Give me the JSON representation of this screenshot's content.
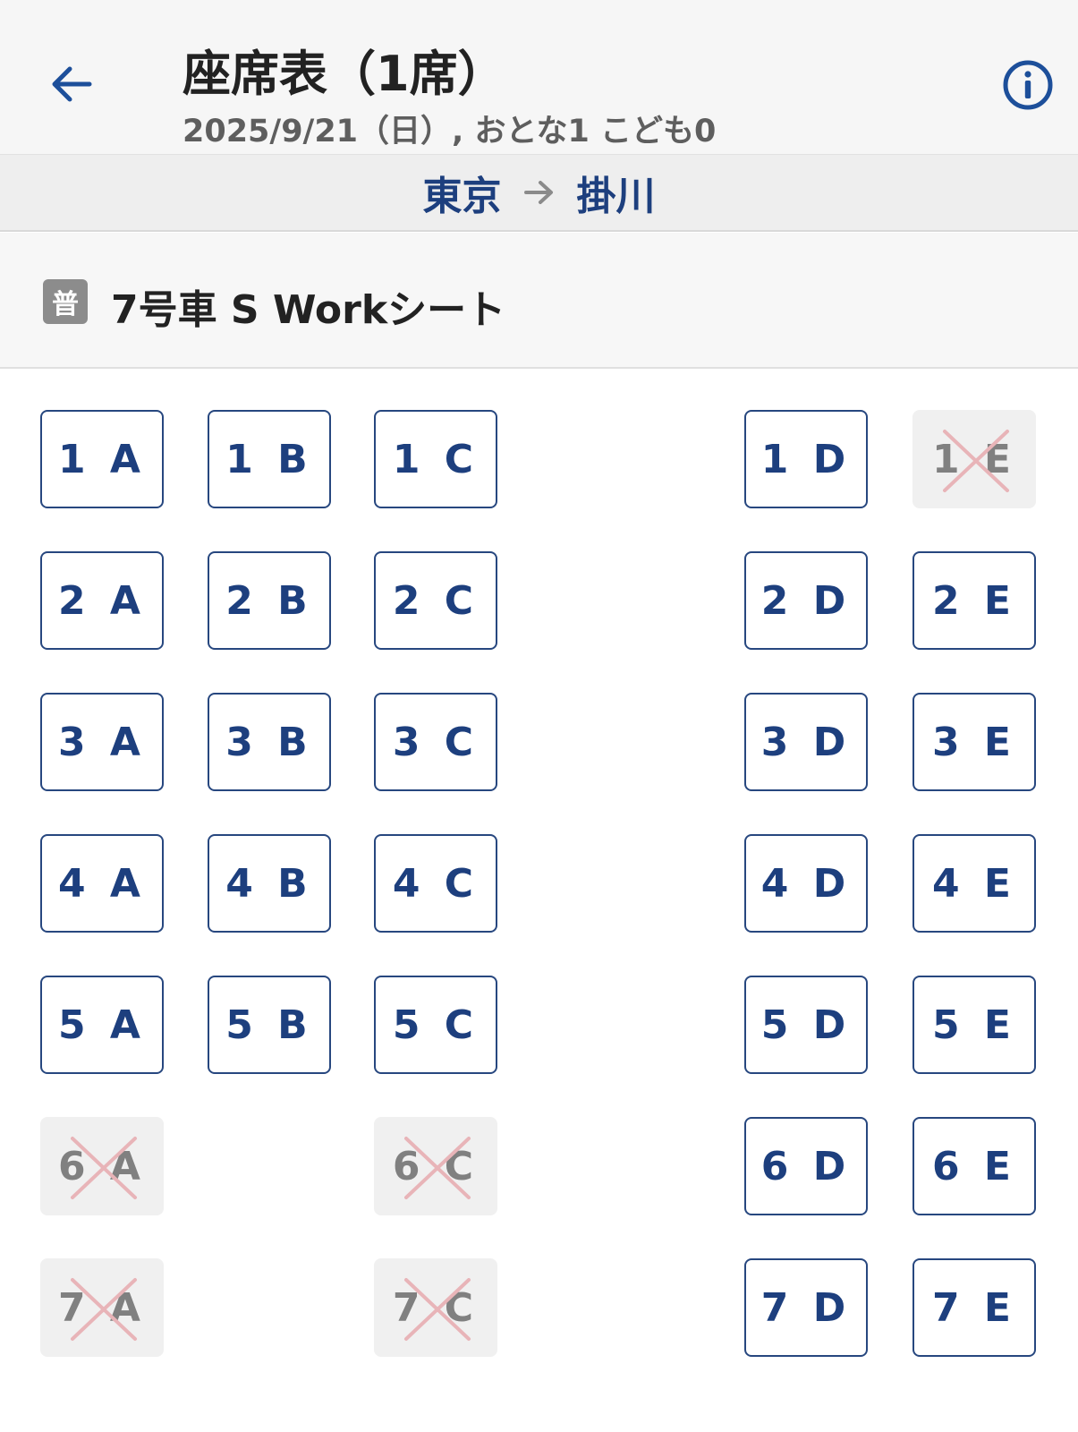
{
  "header": {
    "title": "座席表（1席）",
    "subtitle": "2025/9/21（日）, おとな1 こども0",
    "back_icon": "arrow-left-icon",
    "info_icon": "info-circle-icon"
  },
  "route": {
    "from": "東京",
    "to": "掛川"
  },
  "car": {
    "badge": "普",
    "name": "7号車 S Workシート"
  },
  "colors": {
    "accent": "#1d3f7e",
    "unavailable_mark": "#e8b4b8",
    "unavailable_bg": "#f0f0f0"
  },
  "seats": [
    {
      "label": "1 A",
      "available": true
    },
    {
      "label": "1 B",
      "available": true
    },
    {
      "label": "1 C",
      "available": true
    },
    {
      "label": "1 D",
      "available": true
    },
    {
      "label": "1 E",
      "available": false
    },
    {
      "label": "2 A",
      "available": true
    },
    {
      "label": "2 B",
      "available": true
    },
    {
      "label": "2 C",
      "available": true
    },
    {
      "label": "2 D",
      "available": true
    },
    {
      "label": "2 E",
      "available": true
    },
    {
      "label": "3 A",
      "available": true
    },
    {
      "label": "3 B",
      "available": true
    },
    {
      "label": "3 C",
      "available": true
    },
    {
      "label": "3 D",
      "available": true
    },
    {
      "label": "3 E",
      "available": true
    },
    {
      "label": "4 A",
      "available": true
    },
    {
      "label": "4 B",
      "available": true
    },
    {
      "label": "4 C",
      "available": true
    },
    {
      "label": "4 D",
      "available": true
    },
    {
      "label": "4 E",
      "available": true
    },
    {
      "label": "5 A",
      "available": true
    },
    {
      "label": "5 B",
      "available": true
    },
    {
      "label": "5 C",
      "available": true
    },
    {
      "label": "5 D",
      "available": true
    },
    {
      "label": "5 E",
      "available": true
    },
    {
      "label": "6 A",
      "available": false
    },
    {
      "label": "6 C",
      "available": false
    },
    {
      "label": "6 D",
      "available": true
    },
    {
      "label": "6 E",
      "available": true
    },
    {
      "label": "7 A",
      "available": false
    },
    {
      "label": "7 C",
      "available": false
    },
    {
      "label": "7 D",
      "available": true
    },
    {
      "label": "7 E",
      "available": true
    }
  ]
}
